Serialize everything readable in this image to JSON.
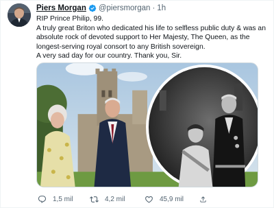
{
  "tweet": {
    "author_name": "Piers Morgan",
    "handle": "@piersmorgan",
    "separator": "·",
    "time": "1h",
    "text_lines": [
      "RIP Prince Philip, 99.",
      "A truly great Briton who dedicated his life to selfless public duty & was an",
      "absolute rock of devoted support to Her Majesty, The Queen, as the",
      "longest-serving royal consort to any British sovereign.",
      "A very sad day for our country. Thank you, Sir."
    ],
    "media_icon": "photo-collage",
    "actions": {
      "reply_count": "1,5 mil",
      "retweet_count": "4,2 mil",
      "like_count": "45,9 mil"
    },
    "icons": {
      "verified": "verified-badge-icon",
      "reply": "reply-icon",
      "retweet": "retweet-icon",
      "like": "heart-icon",
      "share": "share-icon"
    },
    "colors": {
      "verified": "#1d9bf0",
      "secondary_text": "#536471",
      "primary_text": "#0f1419"
    }
  }
}
